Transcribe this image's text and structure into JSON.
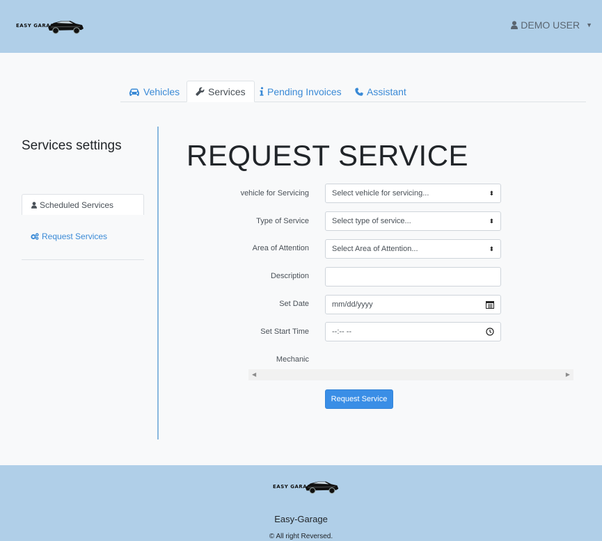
{
  "navbar": {
    "brand_text": "EASY GARAGE",
    "user_label": "DEMO USER",
    "user_icon": "user-icon",
    "caret_icon": "caret-down-icon"
  },
  "tabs": [
    {
      "label": "Vehicles",
      "icon": "car-icon",
      "active": false
    },
    {
      "label": "Services",
      "icon": "wrench-icon",
      "active": true
    },
    {
      "label": "Pending Invoices",
      "icon": "info-icon",
      "active": false
    },
    {
      "label": "Assistant",
      "icon": "phone-icon",
      "active": false
    }
  ],
  "sidebar": {
    "title": "Services settings",
    "items": [
      {
        "label": "Scheduled Services",
        "icon": "user-icon",
        "active": true
      },
      {
        "label": "Request Services",
        "icon": "cogs-icon",
        "active": false
      }
    ]
  },
  "form": {
    "title": "REQUEST SERVICE",
    "vehicle": {
      "label": "vehicle for Servicing",
      "value": "Select vehicle for servicing..."
    },
    "service_type": {
      "label": "Type of Service",
      "value": "Select type of service..."
    },
    "area": {
      "label": "Area of Attention",
      "value": "Select Area of Attention..."
    },
    "description": {
      "label": "Description",
      "value": ""
    },
    "date": {
      "label": "Set Date",
      "value": "mm/dd/yyyy",
      "icon": "calendar-icon"
    },
    "time": {
      "label": "Set Start Time",
      "value": "--:-- --",
      "icon": "clock-icon"
    },
    "mechanic": {
      "label": "Mechanic"
    },
    "submit_label": "Request Service"
  },
  "footer": {
    "brand_text": "EASY GARAGE",
    "name": "Easy-Garage",
    "copyright": "© All right Reversed."
  },
  "colors": {
    "navbar_bg": "#b0cfe8",
    "link": "#3a8ad6",
    "primary": "#3a8ee6",
    "divider": "#8ab8de"
  }
}
